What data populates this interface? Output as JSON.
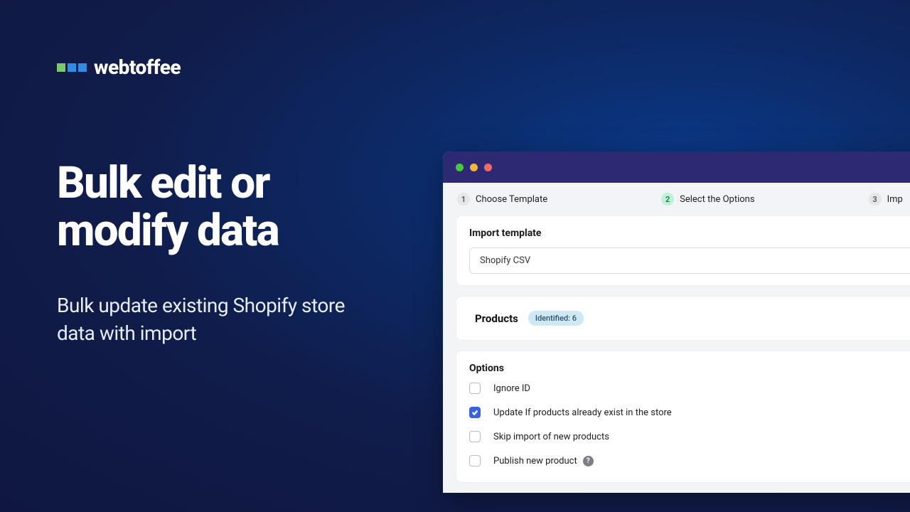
{
  "brand": {
    "name": "webtoffee"
  },
  "hero": {
    "title": "Bulk edit or modify data",
    "subtitle": "Bulk update existing Shopify store data with import"
  },
  "wizard": {
    "steps": [
      {
        "num": "1",
        "label": "Choose Template"
      },
      {
        "num": "2",
        "label": "Select the Options"
      },
      {
        "num": "3",
        "label": "Imp"
      }
    ]
  },
  "import_card": {
    "title": "Import template",
    "selected": "Shopify CSV"
  },
  "products_card": {
    "title": "Products",
    "badge": "Identified: 6"
  },
  "options_card": {
    "title": "Options",
    "items": [
      {
        "label": "Ignore ID",
        "checked": false,
        "help": false
      },
      {
        "label": "Update If products already exist in the store",
        "checked": true,
        "help": false
      },
      {
        "label": "Skip import of new products",
        "checked": false,
        "help": false
      },
      {
        "label": "Publish new product",
        "checked": false,
        "help": true
      }
    ]
  }
}
